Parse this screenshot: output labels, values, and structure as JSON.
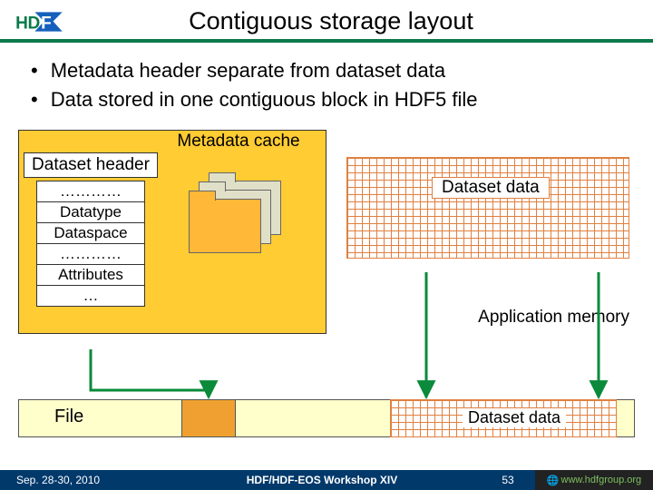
{
  "title": "Contiguous storage layout",
  "bullets": [
    "Metadata header separate from dataset data",
    "Data stored in one contiguous block in HDF5 file"
  ],
  "metadata_cache": {
    "label": "Metadata cache",
    "header_box": "Dataset header",
    "items": [
      "…………",
      "Datatype",
      "Dataspace",
      "…………",
      "Attributes",
      "…"
    ]
  },
  "dataset_data_label_top": "Dataset data",
  "application_memory": "Application memory",
  "file": {
    "label": "File",
    "dataset_data_label": "Dataset data"
  },
  "footer": {
    "date": "Sep. 28-30, 2010",
    "event": "HDF/HDF-EOS Workshop XIV",
    "page": "53",
    "site": "www.hdfgroup.org"
  },
  "colors": {
    "metadata_bg": "#ffcc33",
    "grid_line": "#e08040",
    "file_strip": "#ffffcc",
    "file_header": "#f0a030",
    "footer_bg": "#01396b",
    "accent_green": "#0a7a4a"
  }
}
